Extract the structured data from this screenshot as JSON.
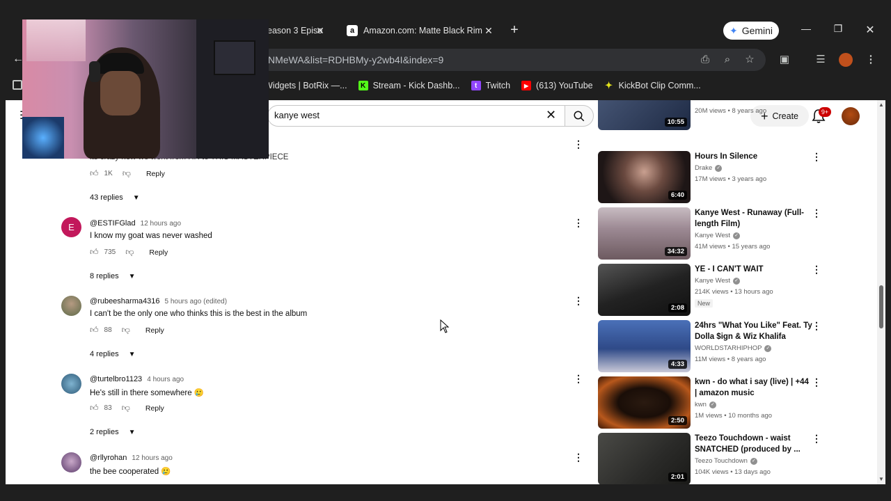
{
  "browser": {
    "tabs": [
      {
        "label": "eason 3 Episo",
        "favicon": ""
      },
      {
        "label": "Amazon.com: Matte Black Rim",
        "favicon": "a"
      }
    ],
    "gemini_label": "Gemini",
    "url": "NMeWA&list=RDHBMy-y2wb4I&index=9",
    "bookmarks": [
      {
        "label": "Widgets | BotRix —...",
        "icon": "",
        "color": ""
      },
      {
        "label": "Stream - Kick Dashb...",
        "icon": "K",
        "color": "#53fc18"
      },
      {
        "label": "Twitch",
        "icon": "t",
        "color": "#9146ff"
      },
      {
        "label": "(613) YouTube",
        "icon": "▶",
        "color": "#ff0000"
      },
      {
        "label": "KickBot Clip Comm...",
        "icon": "✦",
        "color": "#e2e21c"
      }
    ]
  },
  "youtube": {
    "search_query": "kanye west",
    "create_label": "Create",
    "notification_badge": "9+",
    "partial_comment_text": "its crazy how we went from HH to THIS MASTERPIECE",
    "comments": [
      {
        "likes": "1K",
        "reply_label": "Reply",
        "replies_label": "43 replies"
      },
      {
        "author": "@ESTIFGlad",
        "time": "12 hours ago",
        "text": "I know my goat was never washed",
        "likes": "735",
        "reply_label": "Reply",
        "replies_label": "8 replies",
        "avatar_letter": "E",
        "avatar_color": "#c2185b"
      },
      {
        "author": "@rubeesharma4316",
        "time": "5 hours ago (edited)",
        "text": "I can't be the only one who thinks this is the best in the album",
        "likes": "88",
        "reply_label": "Reply",
        "replies_label": "4 replies",
        "avatar_letter": "",
        "avatar_color": "#7a8a6a"
      },
      {
        "author": "@turtelbro1123",
        "time": "4 hours ago",
        "text": "He's still in there somewhere 🥲",
        "likes": "83",
        "reply_label": "Reply",
        "replies_label": "2 replies",
        "avatar_letter": "",
        "avatar_color": "#4a7fa0"
      },
      {
        "author": "@rllyrohan",
        "time": "12 hours ago",
        "text": "the bee cooperated 🥲",
        "avatar_letter": "",
        "avatar_color": "#8a6a9a"
      }
    ],
    "recommendations": [
      {
        "title": "",
        "channel": "",
        "meta": "20M views • 8 years ago",
        "duration": "10:55",
        "thumb_color": "#3b4a6b"
      },
      {
        "title": "Hours In Silence",
        "channel": "Drake",
        "meta": "17M views • 3 years ago",
        "duration": "6:40",
        "thumb_color": "#3a2a2a",
        "verified": true
      },
      {
        "title": "Kanye West - Runaway (Full-length Film)",
        "channel": "Kanye West",
        "meta": "41M views • 15 years ago",
        "duration": "34:32",
        "thumb_color": "#9a8a90",
        "verified": true
      },
      {
        "title": "YE - I CAN'T WAIT",
        "channel": "Kanye West",
        "meta": "214K views • 13 hours ago",
        "duration": "2:08",
        "thumb_color": "#2e2e2e",
        "verified": true,
        "badge": "New"
      },
      {
        "title": "24hrs \"What You Like\" Feat. Ty Dolla $ign & Wiz Khalifa (WSH...",
        "channel": "WORLDSTARHIPHOP",
        "meta": "11M views • 8 years ago",
        "duration": "4:33",
        "thumb_color": "#3f5a9a",
        "verified": true
      },
      {
        "title": "kwn - do what i say (live) | +44 | amazon music",
        "channel": "kwn",
        "meta": "1M views • 10 months ago",
        "duration": "2:50",
        "thumb_color": "#6a3a1a",
        "verified": true
      },
      {
        "title": "Teezo Touchdown - waist SNATCHED (produced by ...",
        "channel": "Teezo Touchdown",
        "meta": "104K views • 13 days ago",
        "duration": "2:01",
        "thumb_color": "#3a3a38",
        "verified": true
      }
    ]
  },
  "colors": {
    "accent": "#0f0f0f",
    "badge": "#cc0000",
    "avatar_e": "#c2185b"
  }
}
